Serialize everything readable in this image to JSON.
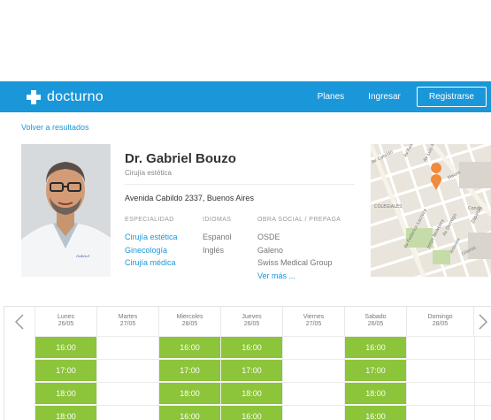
{
  "nav": {
    "brand": "docturno",
    "links": [
      "Planes",
      "Ingresar"
    ],
    "register_label": "Registrarse"
  },
  "back_link": "Volver a resultados",
  "doctor": {
    "name": "Dr. Gabriel Bouzo",
    "specialty": "Cirujía estética",
    "address": "Avenida Cabildo 2337, Buenos Aires"
  },
  "columns": {
    "especialidad": {
      "header": "ESPECIALIDAD",
      "items": [
        "Cirujía estética",
        "Ginecología",
        "Cirujía médica"
      ]
    },
    "idiomas": {
      "header": "IDIOMAS",
      "items": [
        "Espanol",
        "Inglés"
      ]
    },
    "obra_social": {
      "header": "OBRA SOCIAL / PREPAGA",
      "items": [
        "OSDE",
        "Galeno",
        "Swiss Medical Group"
      ],
      "more": "Ver más ..."
    }
  },
  "map": {
    "streets": [
      "Av Cabildo",
      "Av Federico L",
      "Av Luis María Campos",
      "Maure",
      "COLEGIALES",
      "Av Federico Lacroze",
      "Jorge Newbery",
      "Av Dorrego",
      "Arevalo",
      "Olleros",
      "Zapata",
      "Conde"
    ]
  },
  "calendar": {
    "days": [
      {
        "name": "Lunes",
        "date": "26/05",
        "slots": [
          "16:00",
          "17:00",
          "18:00",
          "18:00"
        ]
      },
      {
        "name": "Martes",
        "date": "27/05",
        "slots": []
      },
      {
        "name": "Miercoles",
        "date": "28/05",
        "slots": [
          "16:00",
          "17:00",
          "18:00",
          "16:00"
        ]
      },
      {
        "name": "Jueves",
        "date": "26/05",
        "slots": [
          "16:00",
          "17:00",
          "18:00",
          "16:00"
        ]
      },
      {
        "name": "Viernes",
        "date": "27/05",
        "slots": []
      },
      {
        "name": "Sabado",
        "date": "26/05",
        "slots": [
          "16:00",
          "17:00",
          "18:00",
          "16:00"
        ]
      },
      {
        "name": "Domingo",
        "date": "28/05",
        "slots": []
      }
    ]
  },
  "colors": {
    "primary": "#1a97d9",
    "slot": "#8cc43a"
  }
}
